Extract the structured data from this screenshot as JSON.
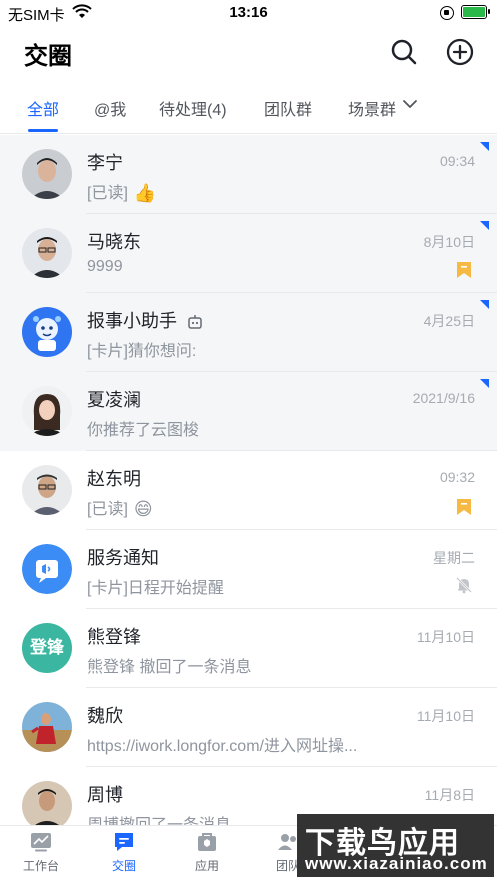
{
  "status_bar": {
    "carrier": "无SIM卡",
    "time": "13:16"
  },
  "header": {
    "title": "交圈"
  },
  "tabs": [
    {
      "label": "全部",
      "active": true
    },
    {
      "label": "@我"
    },
    {
      "label": "待处理(4)"
    },
    {
      "label": "团队群"
    },
    {
      "label": "场景群"
    }
  ],
  "conversations": [
    {
      "name": "李宁",
      "message": "[已读]",
      "emoji": "👍",
      "time": "09:34",
      "pinned": true,
      "unread_corner": true
    },
    {
      "name": "马晓东",
      "message": "9999",
      "time": "8月10日",
      "pinned": true,
      "unread_corner": true,
      "bookmark": true
    },
    {
      "name": "报事小助手",
      "message": "[卡片]猜你想问:",
      "time": "4月25日",
      "pinned": true,
      "unread_corner": true,
      "bot": true
    },
    {
      "name": "夏凌澜",
      "message": "你推荐了云图梭",
      "time": "2021/9/16",
      "pinned": true,
      "unread_corner": true
    },
    {
      "name": "赵东明",
      "message": "[已读]",
      "emoji": "😄",
      "time": "09:32",
      "bookmark": true
    },
    {
      "name": "服务通知",
      "message": "[卡片]日程开始提醒",
      "time": "星期二",
      "muted": true
    },
    {
      "name": "熊登锋",
      "message": "熊登锋 撤回了一条消息",
      "time": "11月10日",
      "avatar_text": "登锋"
    },
    {
      "name": "魏欣",
      "message": "https://iwork.longfor.com/进入网址操...",
      "time": "11月10日"
    },
    {
      "name": "周博",
      "message": "周博撤回了一条消息",
      "time": "11月8日"
    }
  ],
  "tabbar": [
    {
      "label": "工作台"
    },
    {
      "label": "交圈",
      "active": true
    },
    {
      "label": "应用"
    },
    {
      "label": "团队"
    }
  ],
  "watermark": {
    "line1": "下载鸟应用",
    "line2": "www.xiazainiao.com"
  },
  "colors": {
    "accent": "#1a66ff",
    "bookmark": "#f5b944",
    "avatar_green": "#3bb6a1"
  }
}
